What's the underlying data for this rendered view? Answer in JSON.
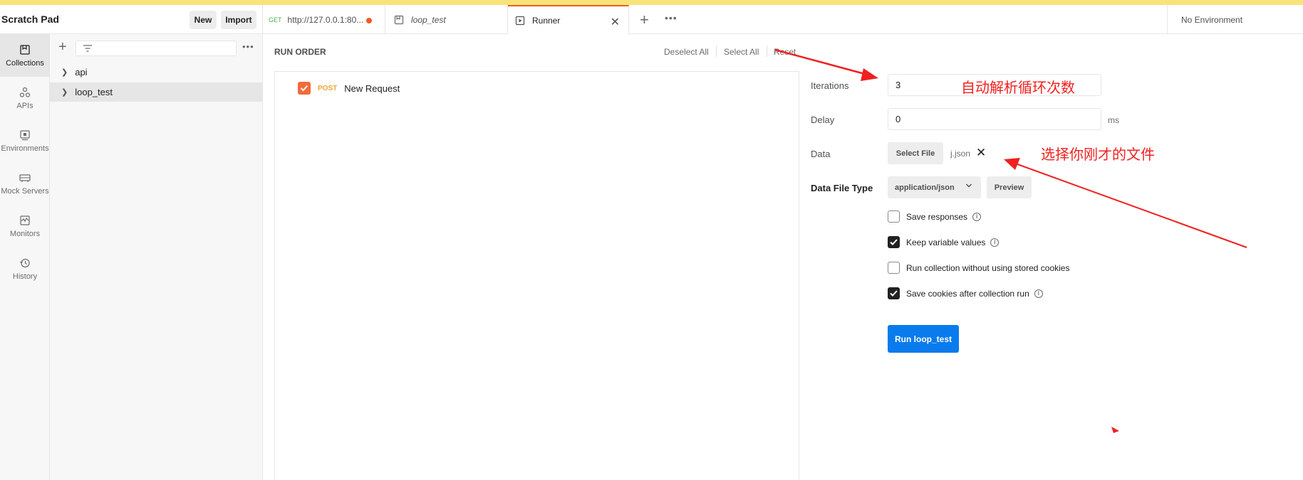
{
  "sidebar_header": {
    "title": "Scratch Pad",
    "new_label": "New",
    "import_label": "Import"
  },
  "tabs": [
    {
      "method": "GET",
      "label": "http://127.0.0.1:80..."
    },
    {
      "label": "loop_test"
    },
    {
      "label": "Runner"
    }
  ],
  "environment": "No Environment",
  "rail": [
    {
      "label": "Collections",
      "icon": "collections-icon"
    },
    {
      "label": "APIs",
      "icon": "apis-icon"
    },
    {
      "label": "Environments",
      "icon": "environments-icon"
    },
    {
      "label": "Mock Servers",
      "icon": "mock-servers-icon"
    },
    {
      "label": "Monitors",
      "icon": "monitors-icon"
    },
    {
      "label": "History",
      "icon": "history-icon"
    }
  ],
  "collections": [
    {
      "label": "api"
    },
    {
      "label": "loop_test"
    }
  ],
  "run_order": {
    "title": "RUN ORDER",
    "deselect_all": "Deselect All",
    "select_all": "Select All",
    "reset": "Reset",
    "requests": [
      {
        "method": "POST",
        "name": "New Request",
        "checked": true
      }
    ]
  },
  "form": {
    "iterations_label": "Iterations",
    "iterations_value": "3",
    "delay_label": "Delay",
    "delay_value": "0",
    "delay_unit": "ms",
    "data_label": "Data",
    "select_file": "Select File",
    "file_name": "j.json",
    "data_file_type_label": "Data File Type",
    "data_file_type_value": "application/json",
    "preview": "Preview",
    "options": [
      {
        "label": "Save responses",
        "checked": false,
        "info": true
      },
      {
        "label": "Keep variable values",
        "checked": true,
        "info": true
      },
      {
        "label": "Run collection without using stored cookies",
        "checked": false,
        "info": false
      },
      {
        "label": "Save cookies after collection run",
        "checked": true,
        "info": true
      }
    ],
    "run_button": "Run loop_test"
  },
  "annotations": {
    "iterations_note": "自动解析循环次数",
    "file_note": "选择你刚才的文件",
    "color": "#f02020"
  },
  "colors": {
    "accent_orange": "#f26b3a",
    "primary_blue": "#097bed",
    "top_strip": "#f7e37a"
  }
}
